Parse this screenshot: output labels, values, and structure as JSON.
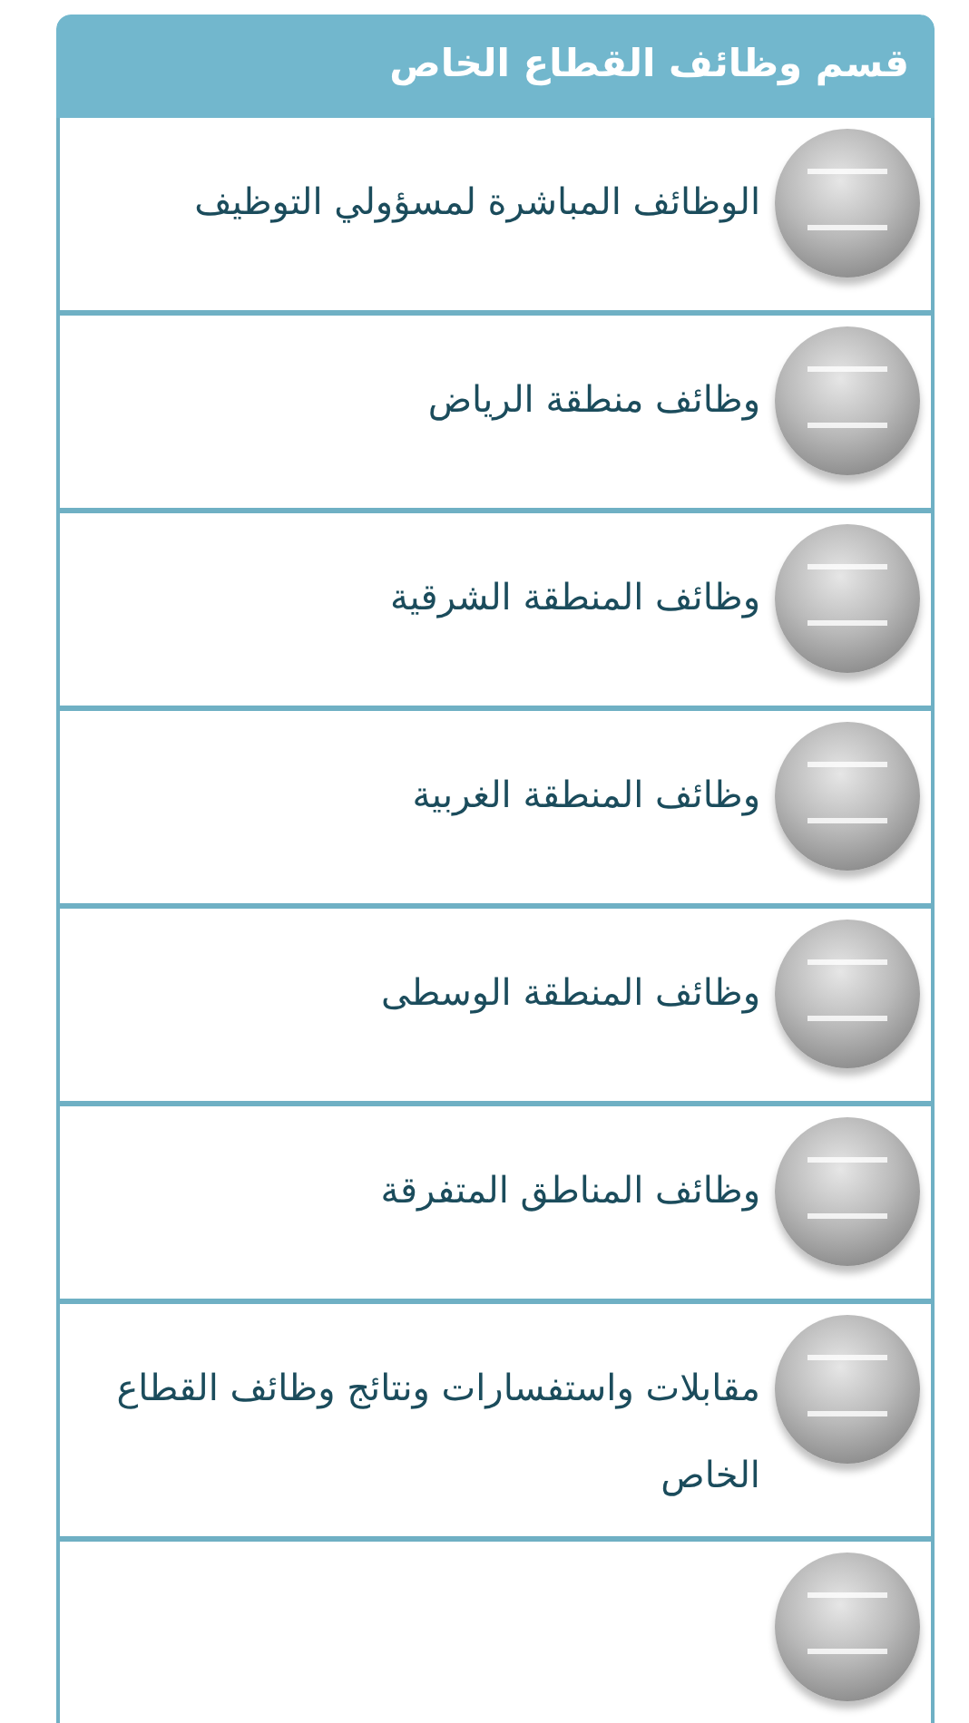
{
  "section": {
    "title": "قسم وظائف القطاع الخاص",
    "items": [
      {
        "label": "الوظائف المباشرة لمسؤولي التوظيف"
      },
      {
        "label": "وظائف منطقة الرياض"
      },
      {
        "label": "وظائف المنطقة الشرقية"
      },
      {
        "label": "وظائف المنطقة الغربية"
      },
      {
        "label": "وظائف المنطقة الوسطى"
      },
      {
        "label": "وظائف المناطق المتفرقة"
      },
      {
        "label": "مقابلات واستفسارات ونتائج وظائف القطاع الخاص"
      }
    ]
  }
}
